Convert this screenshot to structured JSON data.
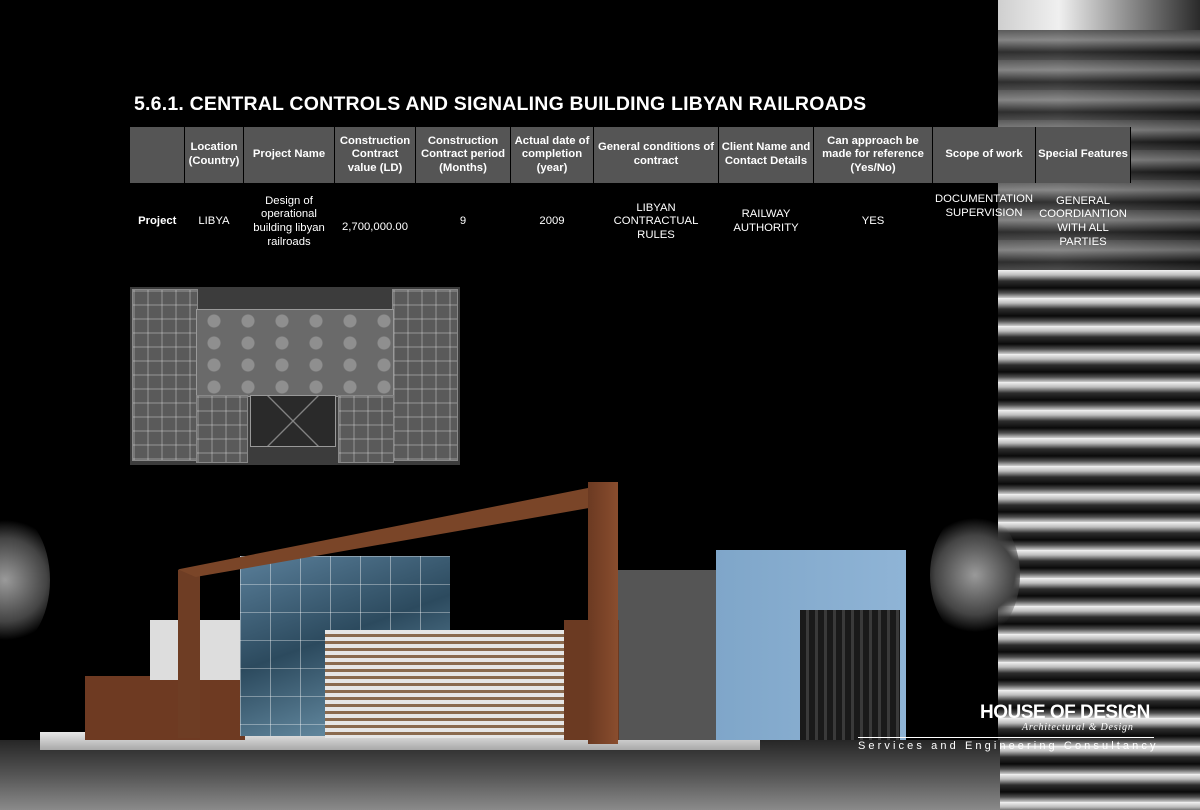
{
  "title": "5.6.1. CENTRAL CONTROLS AND SIGNALING  BUILDING LIBYAN  RAILROADS",
  "table": {
    "headers": [
      "",
      "Location (Country)",
      "Project Name",
      "Construction Contract value (LD)",
      "Construction Contract period (Months)",
      "Actual date of completion (year)",
      "General conditions of contract",
      "Client Name and Contact Details",
      "Can approach be made for reference (Yes/No)",
      "Scope of work",
      "Special Features"
    ],
    "row": [
      "Project",
      "LIBYA",
      "Design of operational building  libyan railroads",
      "2,700,000.00",
      "9",
      "2009",
      "LIBYAN CONTRACTUAL RULES",
      "RAILWAY AUTHORITY",
      "YES",
      "DOCUMENTATION SUPERVISION",
      "GENERAL COORDIANTION WITH ALL PARTIES"
    ]
  },
  "logo": {
    "name": "HOUSE OF DESIGN",
    "subtitle": "Architectural & Design",
    "tagline": "Services and Engineering Consultancy"
  }
}
